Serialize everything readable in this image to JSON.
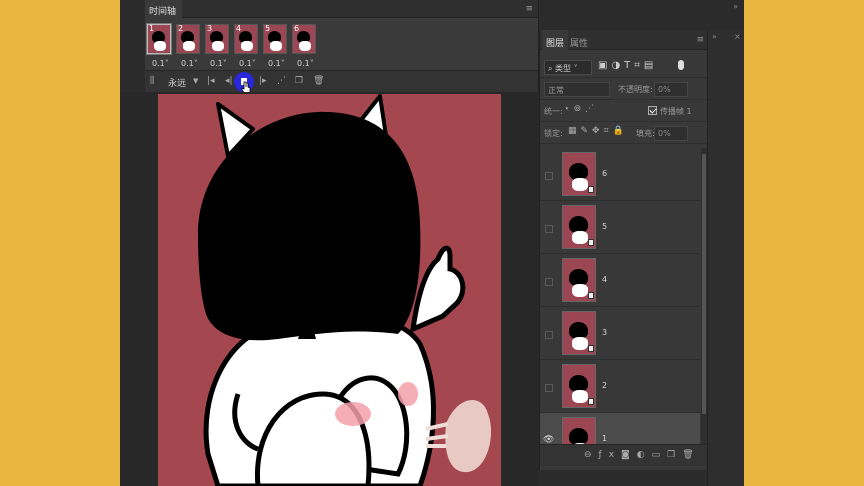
{
  "timeline": {
    "title": "时间轴",
    "frames": [
      {
        "number": "1",
        "delay": "0.1"
      },
      {
        "number": "2",
        "delay": "0.1"
      },
      {
        "number": "3",
        "delay": "0.1"
      },
      {
        "number": "4",
        "delay": "0.1"
      },
      {
        "number": "5",
        "delay": "0.1"
      },
      {
        "number": "6",
        "delay": "0.1"
      }
    ],
    "loop_option": "永远"
  },
  "layers_panel": {
    "tabs": [
      "图层",
      "属性"
    ],
    "active_tab": "图层",
    "filter_label": "类型",
    "blend_mode": "正常",
    "opacity_label": "不透明度:",
    "opacity_value": "0%",
    "unify_label": "统一:",
    "propagate_label": "传播帧 1",
    "lock_label": "锁定:",
    "fill_label": "填充:",
    "fill_value": "0%",
    "layers": [
      {
        "name": "6",
        "visible": false
      },
      {
        "name": "5",
        "visible": false
      },
      {
        "name": "4",
        "visible": false
      },
      {
        "name": "3",
        "visible": false
      },
      {
        "name": "2",
        "visible": false
      },
      {
        "name": "1",
        "visible": true,
        "selected": true
      }
    ]
  },
  "colors": {
    "desktop_bg": "#E8B63F",
    "canvas_bg": "#A4474F",
    "play_highlight": "#2A27D9"
  }
}
